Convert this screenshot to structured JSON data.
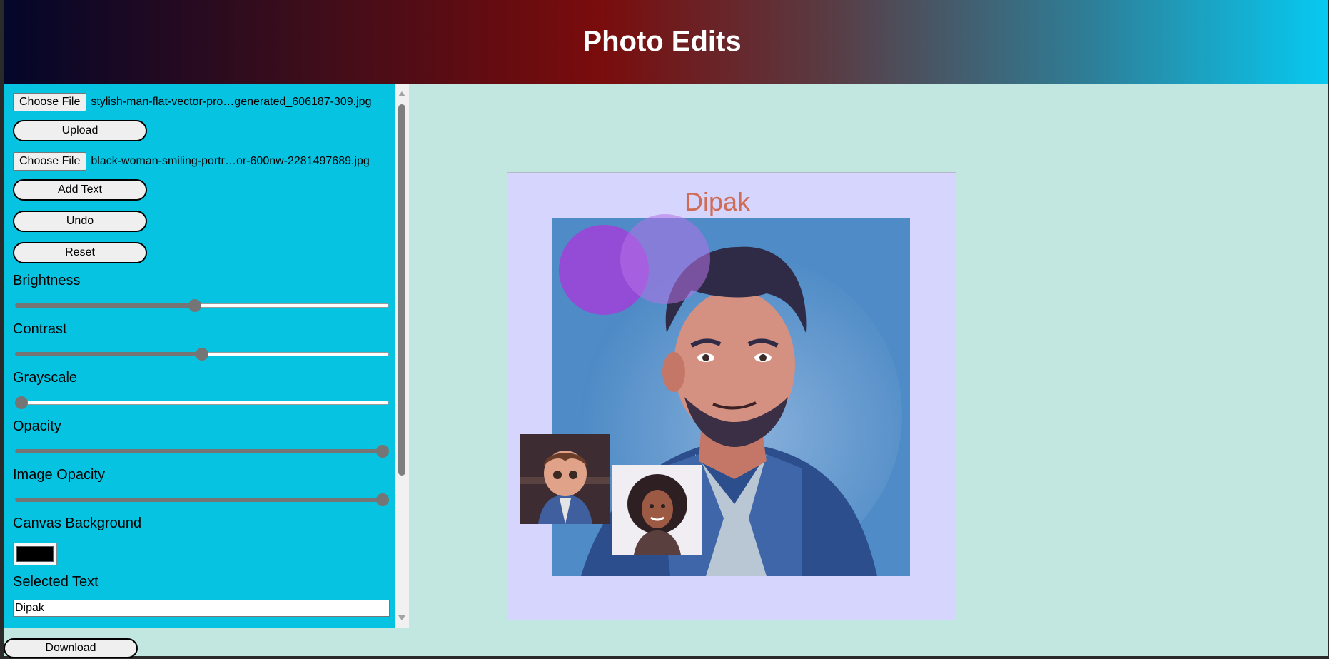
{
  "header": {
    "title": "Photo Edits"
  },
  "sidebar": {
    "file1": {
      "button": "Choose File",
      "filename": "stylish-man-flat-vector-pro…generated_606187-309.jpg"
    },
    "upload_label": "Upload",
    "file2": {
      "button": "Choose File",
      "filename": "black-woman-smiling-portr…or-600nw-2281497689.jpg"
    },
    "add_text_label": "Add Text",
    "undo_label": "Undo",
    "reset_label": "Reset",
    "sliders": [
      {
        "label": "Brightness",
        "value": 0.48
      },
      {
        "label": "Contrast",
        "value": 0.5
      },
      {
        "label": "Grayscale",
        "value": 0.0
      },
      {
        "label": "Opacity",
        "value": 1.0
      },
      {
        "label": "Image Opacity",
        "value": 1.0
      }
    ],
    "canvas_bg_label": "Canvas Background",
    "canvas_bg_color": "#000000",
    "selected_text_label": "Selected Text",
    "selected_text_value": "Dipak"
  },
  "download_label": "Download",
  "canvas": {
    "background": "#d6d5fd",
    "text": "Dipak",
    "text_color": "#cf6c56"
  }
}
